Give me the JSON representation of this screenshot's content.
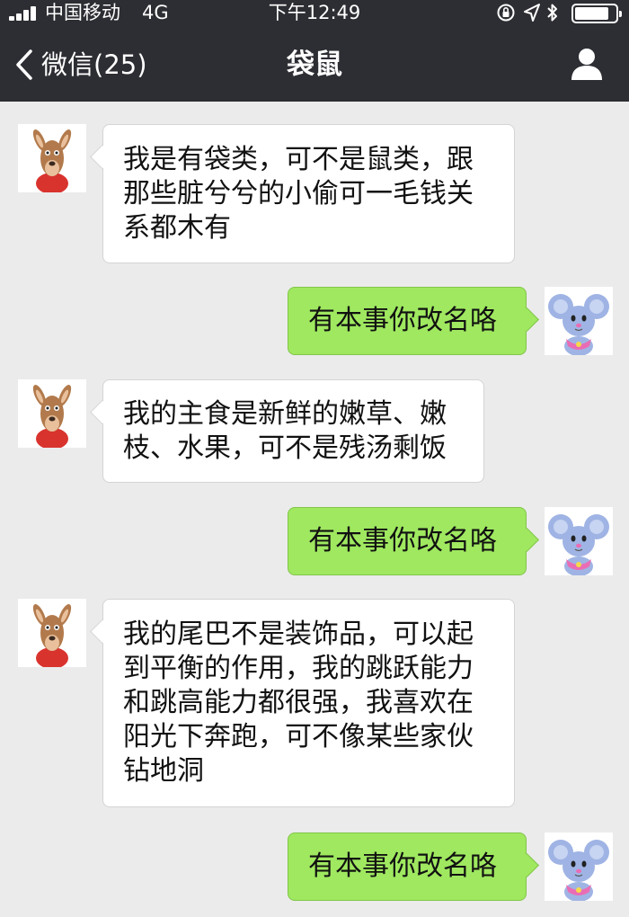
{
  "status_bar": {
    "carrier": "中国移动",
    "network": "4G",
    "time": "下午12:49",
    "battery_level": 0.85
  },
  "nav": {
    "back_label": "微信(25)",
    "title": "袋鼠",
    "back_icon": "chevron-left-icon",
    "profile_icon": "person-icon"
  },
  "messages": [
    {
      "direction": "incoming",
      "sender": "kangaroo",
      "lines": [
        "我是有袋类，可不是鼠类，跟",
        "那些脏兮兮的小偷可一毛钱关",
        "系都木有"
      ]
    },
    {
      "direction": "outgoing",
      "sender": "mouse",
      "lines": [
        "有本事你改名咯"
      ]
    },
    {
      "direction": "incoming",
      "sender": "kangaroo",
      "lines": [
        "我的主食是新鲜的嫩草、嫩",
        "枝、水果，可不是残汤剩饭"
      ]
    },
    {
      "direction": "outgoing",
      "sender": "mouse",
      "lines": [
        "有本事你改名咯"
      ]
    },
    {
      "direction": "incoming",
      "sender": "kangaroo",
      "lines": [
        "我的尾巴不是装饰品，可以起",
        "到平衡的作用，我的跳跃能力",
        "和跳高能力都很强，我喜欢在",
        "阳光下奔跑，可不像某些家伙",
        "钻地洞"
      ]
    },
    {
      "direction": "outgoing",
      "sender": "mouse",
      "lines": [
        "有本事你改名咯"
      ]
    }
  ],
  "colors": {
    "nav_bg": "#2d2e33",
    "chat_bg": "#ebebeb",
    "incoming_bubble": "#ffffff",
    "outgoing_bubble": "#9fe860"
  }
}
